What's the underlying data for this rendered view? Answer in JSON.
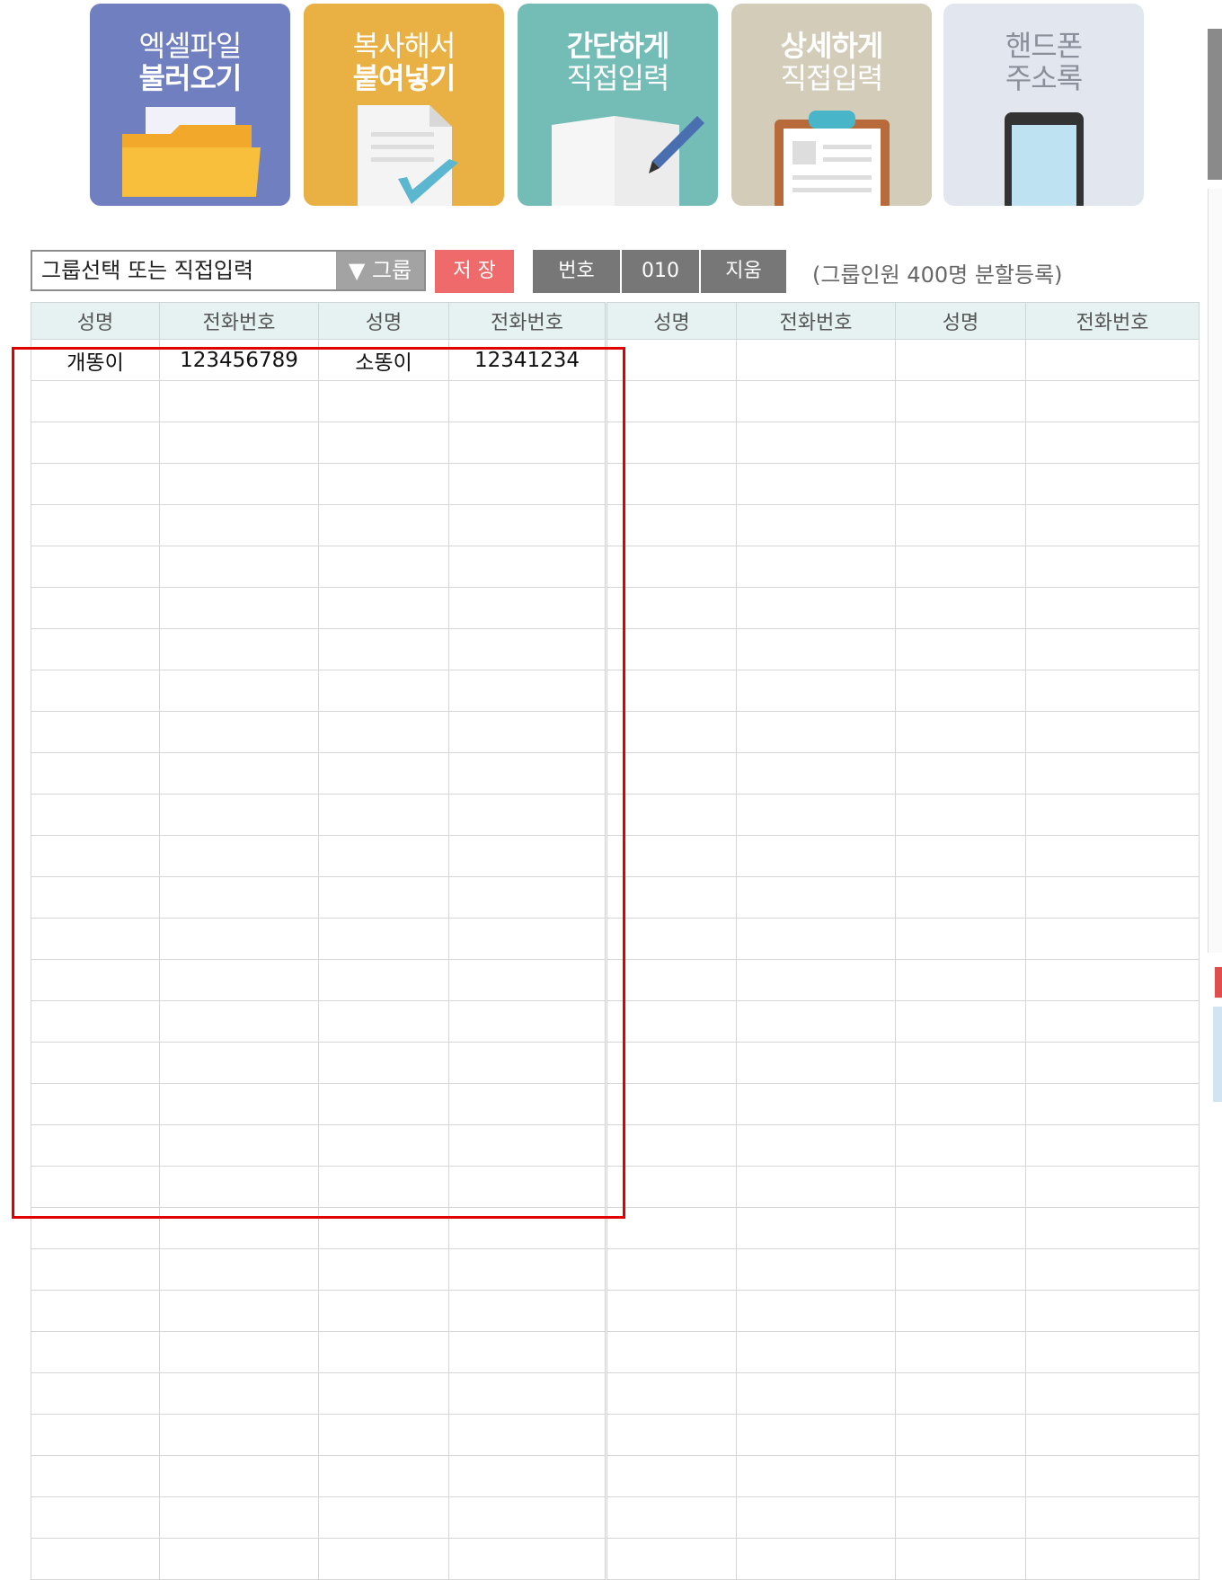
{
  "tiles": [
    {
      "id": "excel",
      "line1": "엑셀파일",
      "line2": "불러오기",
      "icon": "folder-icon"
    },
    {
      "id": "copy",
      "line1": "복사해서",
      "line2": "붙여넣기",
      "icon": "paste-document-icon"
    },
    {
      "id": "simple",
      "line1": "간단하게",
      "line2": "직접입력",
      "icon": "book-pencil-icon"
    },
    {
      "id": "detail",
      "line1": "상세하게",
      "line2": "직접입력",
      "icon": "clipboard-icon"
    },
    {
      "id": "phone",
      "line1": "핸드폰",
      "line2": "주소록",
      "icon": "phone-icon"
    }
  ],
  "toolbar": {
    "group_placeholder": "그룹선택 또는 직접입력",
    "group_button": "▼ 그룹",
    "save": "저 장",
    "number": "번호",
    "prefix": "010",
    "delete": "지움",
    "note": "(그룹인원 400명 분할등록)"
  },
  "table": {
    "headers": [
      "성명",
      "전화번호",
      "성명",
      "전화번호",
      "성명",
      "전화번호",
      "성명",
      "전화번호"
    ],
    "rows": [
      [
        "개똥이",
        "123456789",
        "소똥이",
        "12341234",
        "",
        "",
        "",
        ""
      ]
    ]
  },
  "colors": {
    "save": "#ef6a6a",
    "gray_button": "#777777",
    "header_bg": "#e5f2f1",
    "highlight": "#e00000"
  }
}
